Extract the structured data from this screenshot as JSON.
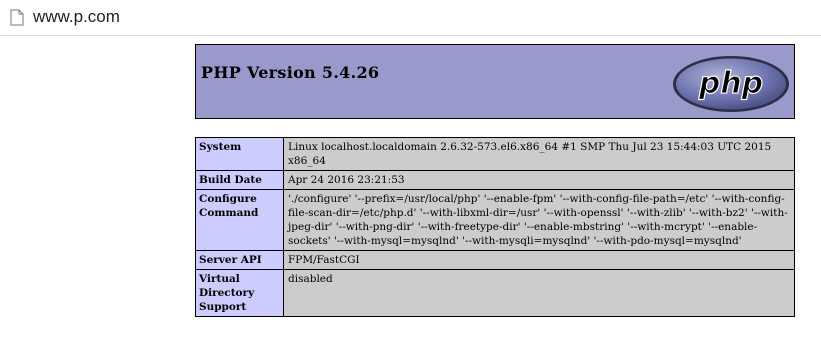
{
  "browser": {
    "url": "www.p.com"
  },
  "header": {
    "title": "PHP Version 5.4.26",
    "logo_text": "php"
  },
  "colors": {
    "header_bg": "#9999cc",
    "key_cell_bg": "#ccccff",
    "value_cell_bg": "#cccccc"
  },
  "rows": [
    {
      "key": "System",
      "value": "Linux localhost.localdomain 2.6.32-573.el6.x86_64 #1 SMP Thu Jul 23 15:44:03 UTC 2015 x86_64"
    },
    {
      "key": "Build Date",
      "value": "Apr 24 2016 23:21:53"
    },
    {
      "key": "Configure Command",
      "value": "'./configure' '--prefix=/usr/local/php' '--enable-fpm' '--with-config-file-path=/etc' '--with-config-file-scan-dir=/etc/php.d' '--with-libxml-dir=/usr' '--with-openssl' '--with-zlib' '--with-bz2' '--with-jpeg-dir' '--with-png-dir' '--with-freetype-dir' '--enable-mbstring' '--with-mcrypt' '--enable-sockets' '--with-mysql=mysqlnd' '--with-mysqli=mysqlnd' '--with-pdo-mysql=mysqlnd'"
    },
    {
      "key": "Server API",
      "value": "FPM/FastCGI"
    },
    {
      "key": "Virtual Directory Support",
      "value": "disabled"
    }
  ]
}
